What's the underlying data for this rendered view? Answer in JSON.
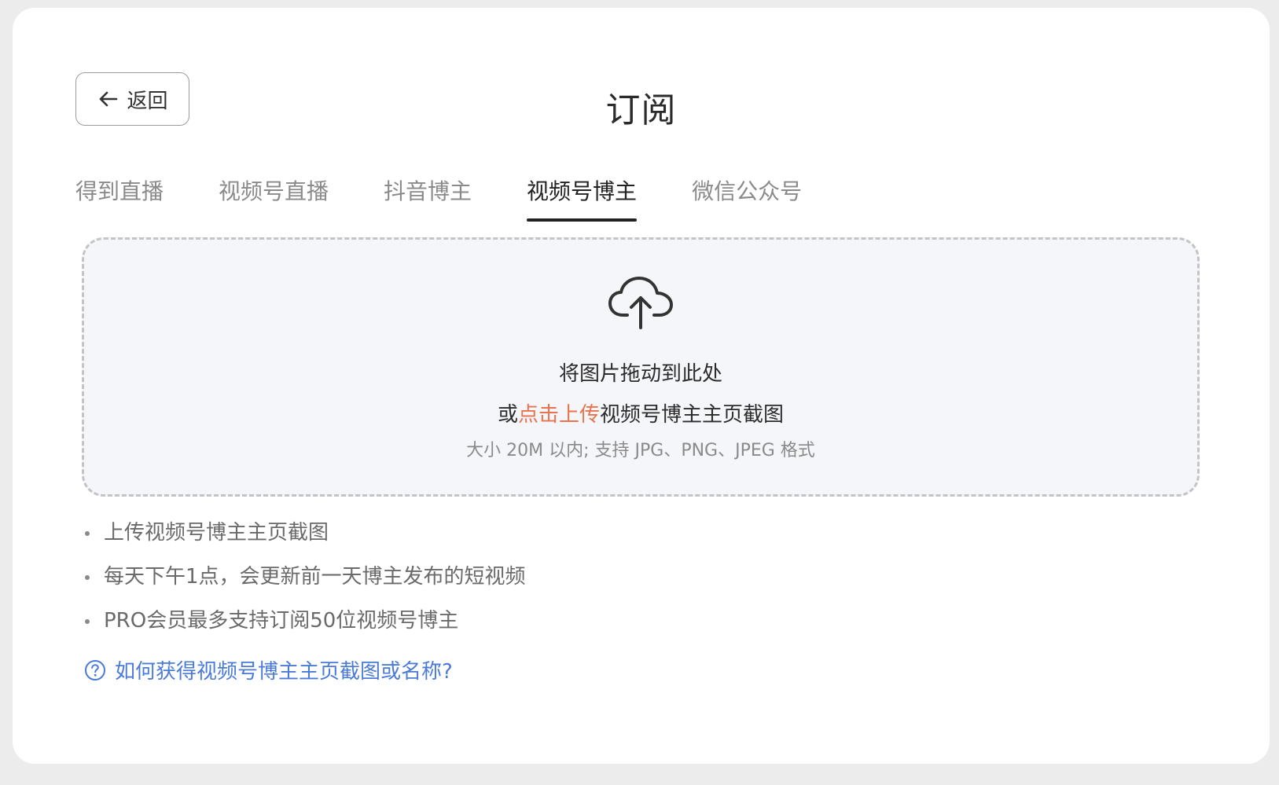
{
  "header": {
    "back_label": "返回",
    "title": "订阅"
  },
  "tabs": [
    {
      "label": "得到直播",
      "active": false
    },
    {
      "label": "视频号直播",
      "active": false
    },
    {
      "label": "抖音博主",
      "active": false
    },
    {
      "label": "视频号博主",
      "active": true
    },
    {
      "label": "微信公众号",
      "active": false
    }
  ],
  "dropzone": {
    "icon": "cloud-upload-icon",
    "line1": "将图片拖动到此处",
    "line2_prefix": "或",
    "line2_link": "点击上传",
    "line2_suffix": "视频号博主主页截图",
    "hint": "大小 20M 以内; 支持 JPG、PNG、JPEG 格式"
  },
  "notes": [
    "上传视频号博主主页截图",
    "每天下午1点，会更新前一天博主发布的短视频",
    "PRO会员最多支持订阅50位视频号博主"
  ],
  "help": {
    "icon": "question-circle-icon",
    "label": "如何获得视频号博主主页截图或名称?"
  },
  "colors": {
    "link_orange": "#e8734d",
    "link_blue": "#4b7bd8",
    "active_tab": "#222222",
    "inactive_tab": "#8a8a8a"
  }
}
